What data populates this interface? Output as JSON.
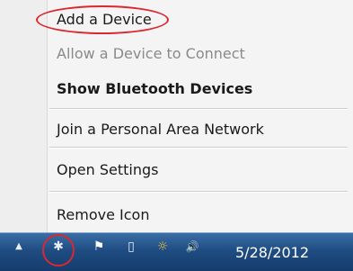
{
  "context_menu": {
    "items": [
      {
        "label": "Add a Device",
        "enabled": true,
        "bold": false
      },
      {
        "label": "Allow a Device to Connect",
        "enabled": false,
        "bold": false
      },
      {
        "label": "Show Bluetooth Devices",
        "enabled": true,
        "bold": true
      },
      {
        "label": "Join a Personal Area Network",
        "enabled": true,
        "bold": false
      },
      {
        "label": "Open Settings",
        "enabled": true,
        "bold": false
      },
      {
        "label": "Remove Icon",
        "enabled": true,
        "bold": false
      }
    ],
    "highlight_color": "#d9282f"
  },
  "taskbar": {
    "tray_icons": [
      {
        "name": "show-hidden-icons-arrow",
        "glyph": "▲"
      },
      {
        "name": "bluetooth-icon",
        "glyph": "✱"
      },
      {
        "name": "action-center-flag-icon",
        "glyph": "⚑"
      },
      {
        "name": "power-icon",
        "glyph": "▯"
      },
      {
        "name": "network-icon",
        "glyph": "☼"
      },
      {
        "name": "volume-icon",
        "glyph": "🔊"
      }
    ],
    "date": "5/28/2012"
  }
}
